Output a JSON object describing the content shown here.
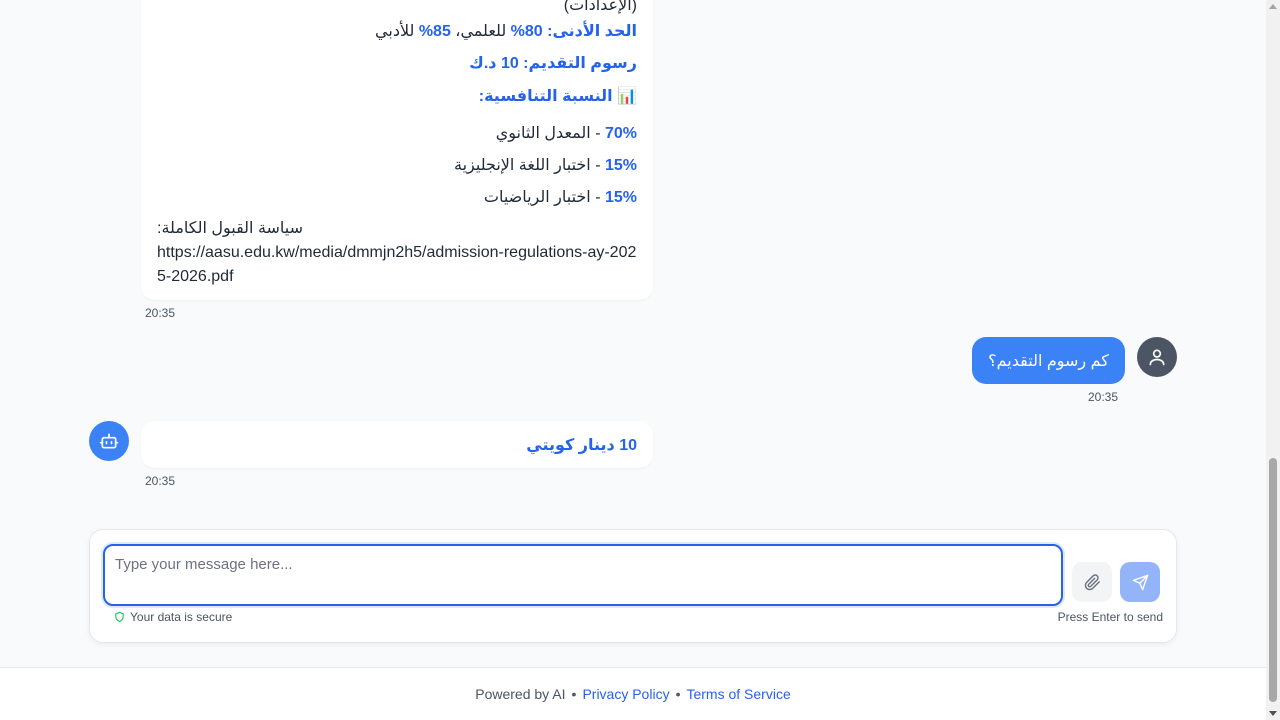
{
  "messages": {
    "bot_reply_1": {
      "cut_line": "(الإعدادات)",
      "min_label": "الحد الأدنى: 80%",
      "min_rest": " للعلمي، ",
      "min_pct": "85%",
      "min_tail": " للأدبي",
      "fees": "رسوم التقديم: 10 د.ك",
      "competitive_icon": "📊",
      "competitive_title": "النسبة التنافسية:",
      "weights": [
        {
          "pct": "70%",
          "label": " - المعدل الثانوي"
        },
        {
          "pct": "15%",
          "label": " - اختبار اللغة الإنجليزية"
        },
        {
          "pct": "15%",
          "label": " - اختبار الرياضيات"
        }
      ],
      "policy_label": "سياسة القبول الكاملة:",
      "policy_url": "https://aasu.edu.kw/media/dmmjn2h5/admission-regulations-ay-2025-2026.pdf",
      "time": "20:35"
    },
    "user_question": {
      "text": "كم رسوم التقديم؟",
      "time": "20:35"
    },
    "bot_reply_2": {
      "text": "10 دينار كويتي",
      "time": "20:35"
    }
  },
  "composer": {
    "placeholder": "Type your message here...",
    "secure_text": "Your data is secure",
    "hint": "Press Enter to send"
  },
  "footer": {
    "powered": "Powered by AI",
    "sep": "•",
    "privacy": "Privacy Policy",
    "terms": "Terms of Service"
  },
  "colors": {
    "accent": "#2563eb",
    "user_bubble": "#3b82f6",
    "send_disabled": "#93b4f8",
    "secure_icon": "#22c55e"
  }
}
